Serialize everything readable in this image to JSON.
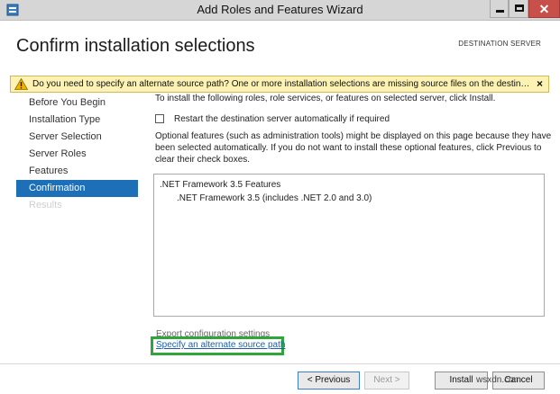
{
  "window": {
    "title": "Add Roles and Features Wizard"
  },
  "header": {
    "page_title": "Confirm installation selections",
    "destination_label": "DESTINATION SERVER"
  },
  "warning": {
    "text": "Do you need to specify an alternate source path? One or more installation selections are missing source files on the destinati...",
    "close_glyph": "×"
  },
  "sidebar": {
    "items": [
      {
        "label": "Before You Begin",
        "state": "normal"
      },
      {
        "label": "Installation Type",
        "state": "normal"
      },
      {
        "label": "Server Selection",
        "state": "normal"
      },
      {
        "label": "Server Roles",
        "state": "normal"
      },
      {
        "label": "Features",
        "state": "normal"
      },
      {
        "label": "Confirmation",
        "state": "active"
      },
      {
        "label": "Results",
        "state": "disabled"
      }
    ]
  },
  "main": {
    "intro": "To install the following roles, role services, or features on selected server, click Install.",
    "restart_label": "Restart the destination server automatically if required",
    "restart_checked": false,
    "optional_text": "Optional features (such as administration tools) might be displayed on this page because they have been selected automatically. If you do not want to install these optional features, click Previous to clear their check boxes.",
    "features": [
      {
        "name": ".NET Framework 3.5 Features",
        "level": 0
      },
      {
        "name": ".NET Framework 3.5 (includes .NET 2.0 and 3.0)",
        "level": 1
      }
    ],
    "export_link": "Export configuration settings",
    "alt_source_link": "Specify an alternate source path"
  },
  "buttons": {
    "previous": "< Previous",
    "next": "Next >",
    "install": "Install",
    "cancel": "Cancel"
  },
  "watermark": "wsxdn.com",
  "colors": {
    "accent": "#1d6fb8",
    "warning_bg": "#fcf2b4",
    "highlight": "#2fa63a",
    "close_button": "#c7504a"
  }
}
